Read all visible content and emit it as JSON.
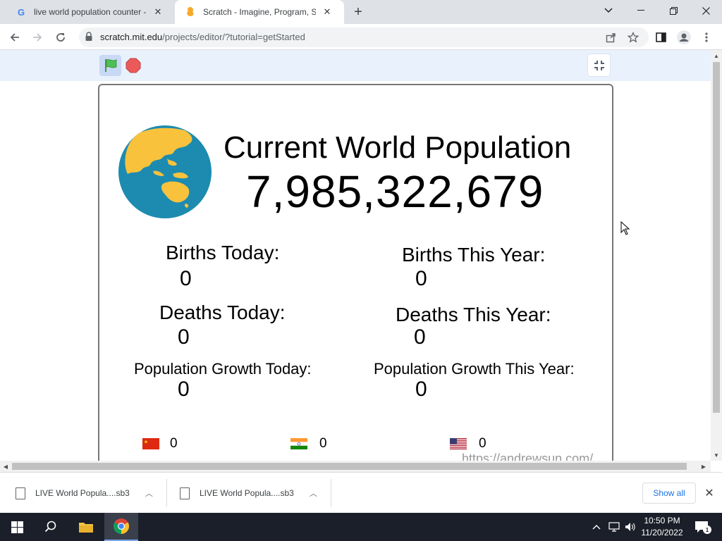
{
  "browser": {
    "tabs": [
      {
        "title": "live world population counter - G",
        "active": false
      },
      {
        "title": "Scratch - Imagine, Program, Shar",
        "active": true
      }
    ],
    "address": {
      "host": "scratch.mit.edu",
      "path": "/projects/editor/?tutorial=getStarted"
    }
  },
  "project": {
    "title": "Current World Population",
    "population": "7,985,322,679",
    "stats": {
      "births_today": {
        "label": "Births Today:",
        "value": "0"
      },
      "births_year": {
        "label": "Births This Year:",
        "value": "0"
      },
      "deaths_today": {
        "label": "Deaths Today:",
        "value": "0"
      },
      "deaths_year": {
        "label": "Deaths This Year:",
        "value": "0"
      },
      "growth_today": {
        "label": "Population Growth Today:",
        "value": "0"
      },
      "growth_year": {
        "label": "Population Growth This Year:",
        "value": "0"
      }
    },
    "countries": [
      {
        "flag": "china",
        "value": "0"
      },
      {
        "flag": "india",
        "value": "0"
      },
      {
        "flag": "usa",
        "value": "0"
      }
    ],
    "watermark": "https://andrewsun.com/"
  },
  "downloads": {
    "items": [
      {
        "name": "LIVE World Popula....sb3"
      },
      {
        "name": "LIVE World Popula....sb3"
      }
    ],
    "show_all": "Show all"
  },
  "taskbar": {
    "time": "10:50 PM",
    "date": "11/20/2022",
    "notification_count": "1"
  },
  "colors": {
    "scratch_blue": "#e9f1fc",
    "flag_green": "#4cbf56",
    "stop_red": "#ec5959"
  }
}
